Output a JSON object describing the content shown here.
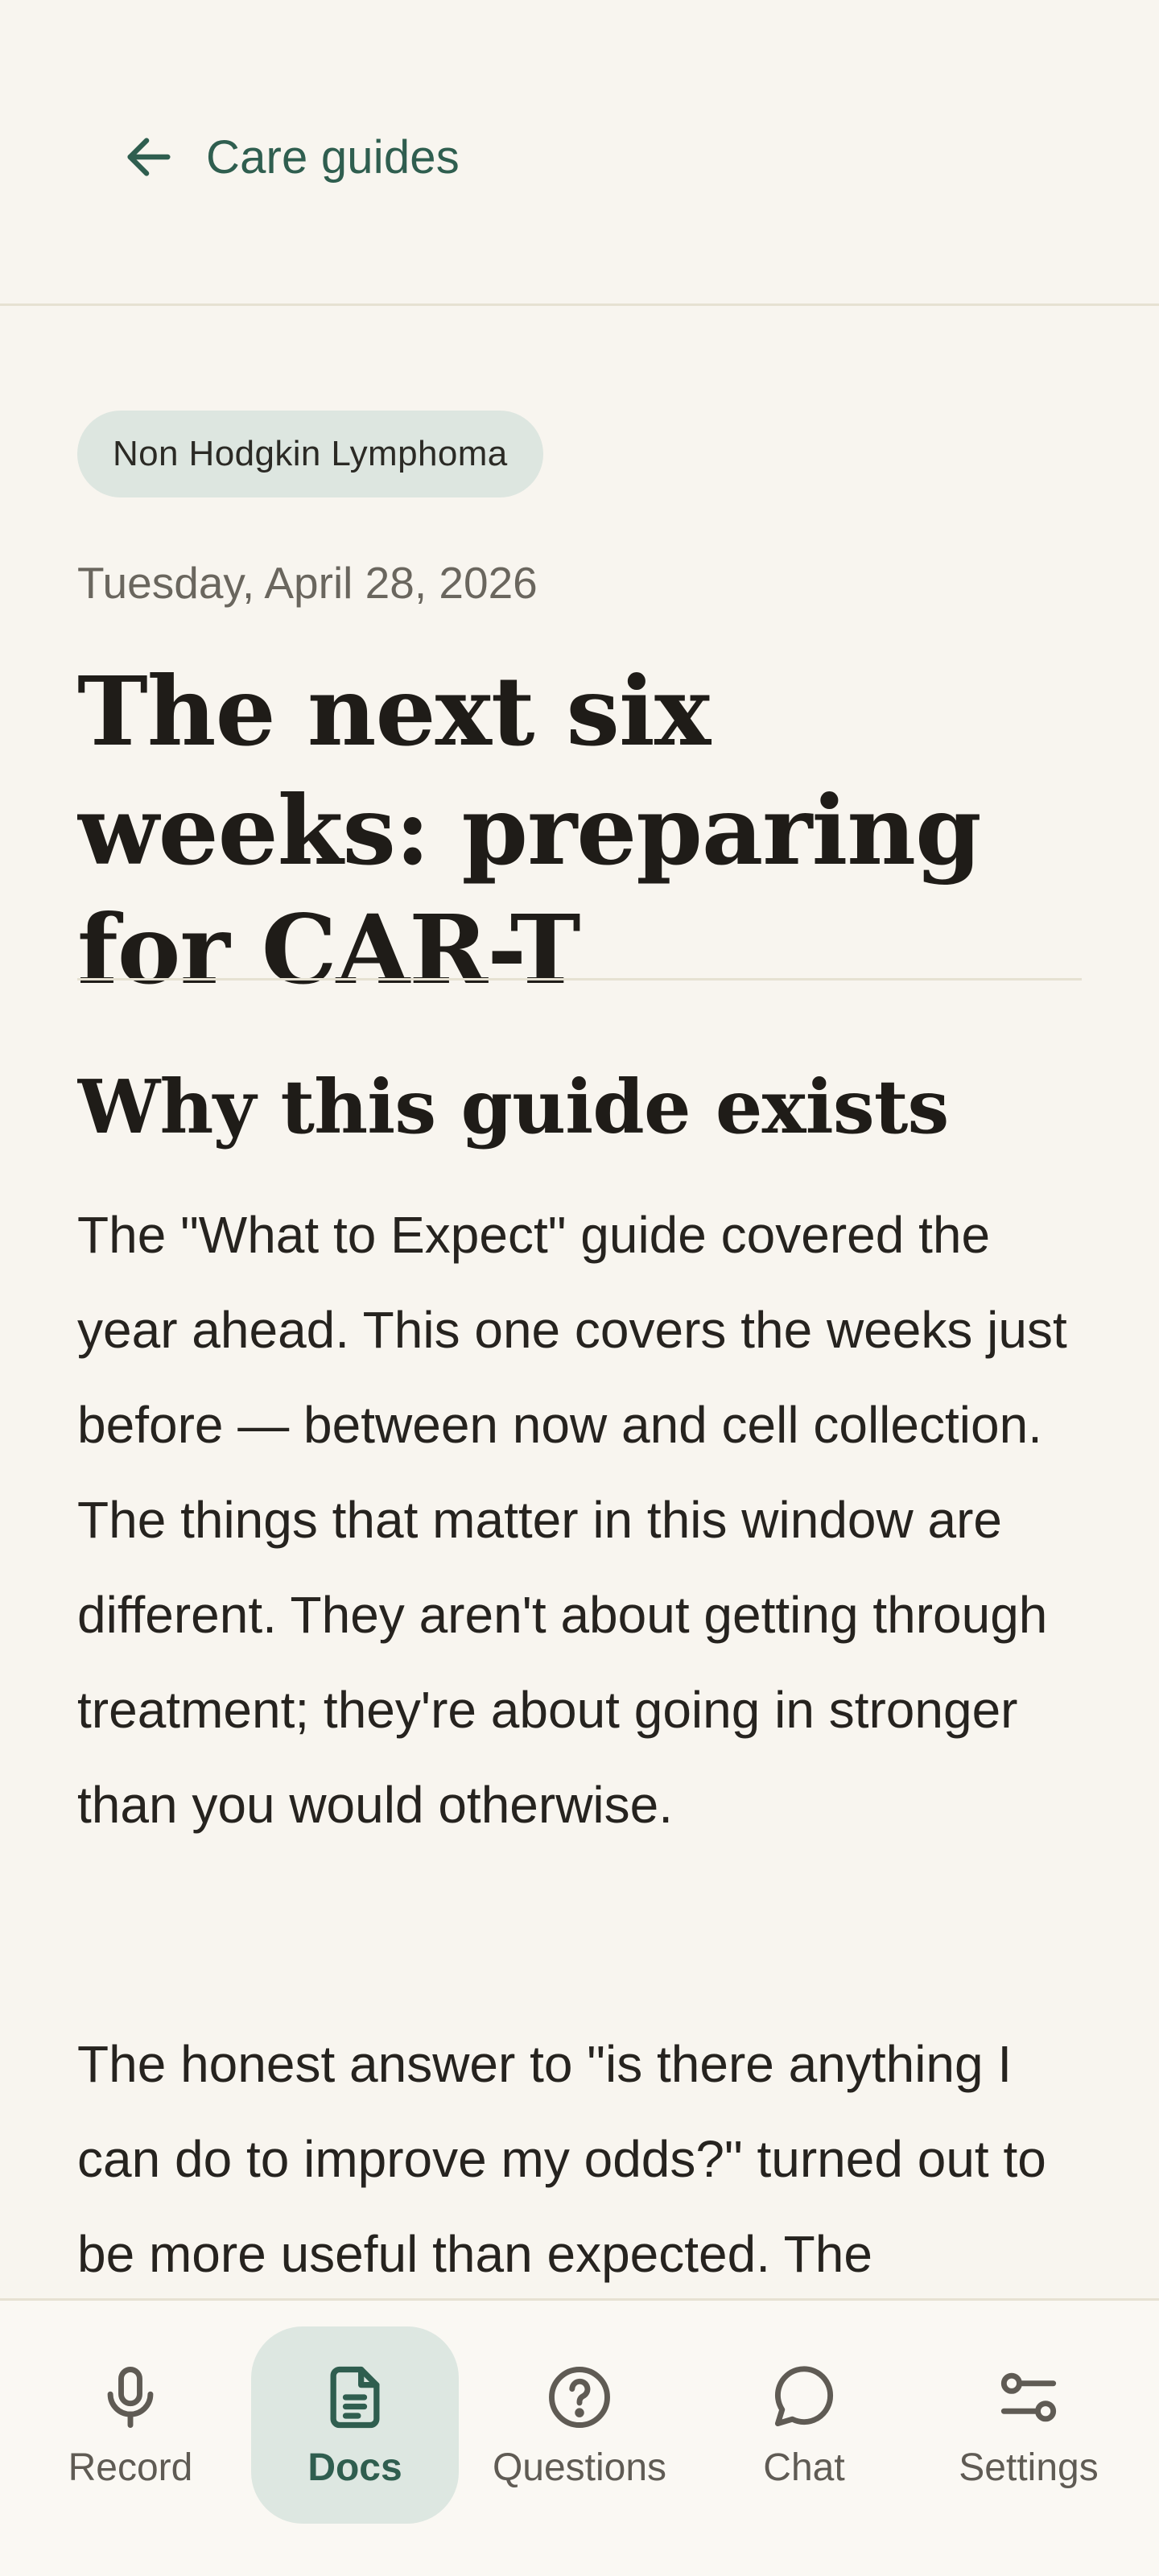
{
  "header": {
    "back_label": "Care guides",
    "back_icon": "arrow-left-icon"
  },
  "article": {
    "tag": "Non Hodgkin Lymphoma",
    "date": "Tuesday, April 28, 2026",
    "title": "The next six weeks: preparing for CAR-T",
    "section_title": "Why this guide exists",
    "paragraphs": [
      "The \"What to Expect\" guide covered the year ahead. This one covers the weeks just before — between now and cell collection. The things that matter in this window are different. They aren't about getting through treatment; they're about going in stronger than you would otherwise.",
      "The honest answer to \"is there anything I can do to improve my odds?\" turned out to be more useful than expected. The"
    ]
  },
  "nav": {
    "active": "docs",
    "items": [
      {
        "key": "record",
        "label": "Record",
        "icon": "microphone-icon"
      },
      {
        "key": "docs",
        "label": "Docs",
        "icon": "document-icon"
      },
      {
        "key": "questions",
        "label": "Questions",
        "icon": "question-circle-icon"
      },
      {
        "key": "chat",
        "label": "Chat",
        "icon": "chat-bubble-icon"
      },
      {
        "key": "settings",
        "label": "Settings",
        "icon": "sliders-icon"
      }
    ]
  },
  "colors": {
    "background": "#f8f5ef",
    "accent": "#2f5e4f",
    "chip_bg": "#dde6e0",
    "active_nav_bg": "#dde7e1",
    "divider": "#e6e1d2"
  }
}
